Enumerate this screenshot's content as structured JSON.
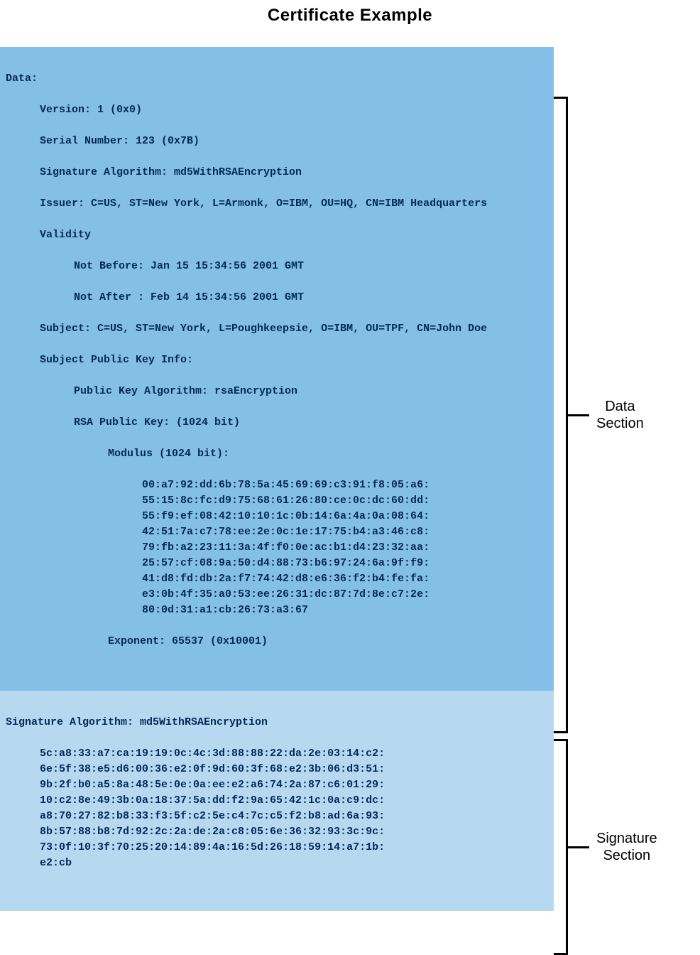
{
  "title": "Certificate Example",
  "labels": {
    "data_section": "Data\nSection",
    "signature_section": "Signature\nSection"
  },
  "cert": {
    "data_header": "Data:",
    "version": "Version: 1 (0x0)",
    "serial": "Serial Number: 123 (0x7B)",
    "sig_alg": "Signature Algorithm: md5WithRSAEncryption",
    "issuer": "Issuer: C=US, ST=New York, L=Armonk, O=IBM, OU=HQ, CN=IBM Headquarters",
    "validity": "Validity",
    "not_before": "Not Before: Jan 15 15:34:56 2001 GMT",
    "not_after": "Not After : Feb 14 15:34:56 2001 GMT",
    "subject": "Subject: C=US, ST=New York, L=Poughkeepsie, O=IBM, OU=TPF, CN=John Doe",
    "spki": "Subject Public Key Info:",
    "pk_alg": "Public Key Algorithm: rsaEncryption",
    "rsa_key": "RSA Public Key: (1024 bit)",
    "modulus": "Modulus (1024 bit):",
    "mod_lines": [
      "00:a7:92:dd:6b:78:5a:45:69:69:c3:91:f8:05:a6:",
      "55:15:8c:fc:d9:75:68:61:26:80:ce:0c:dc:60:dd:",
      "55:f9:ef:08:42:10:10:1c:0b:14:6a:4a:0a:08:64:",
      "42:51:7a:c7:78:ee:2e:0c:1e:17:75:b4:a3:46:c8:",
      "79:fb:a2:23:11:3a:4f:f0:0e:ac:b1:d4:23:32:aa:",
      "25:57:cf:08:9a:50:d4:88:73:b6:97:24:6a:9f:f9:",
      "41:d8:fd:db:2a:f7:74:42:d8:e6:36:f2:b4:fe:fa:",
      "e3:0b:4f:35:a0:53:ee:26:31:dc:87:7d:8e:c7:2e:",
      "80:0d:31:a1:cb:26:73:a3:67"
    ],
    "exponent": "Exponent: 65537 (0x10001)"
  },
  "sig": {
    "alg": "Signature Algorithm: md5WithRSAEncryption",
    "lines": [
      "5c:a8:33:a7:ca:19:19:0c:4c:3d:88:88:22:da:2e:03:14:c2:",
      "6e:5f:38:e5:d6:00:36:e2:0f:9d:60:3f:68:e2:3b:06:d3:51:",
      "9b:2f:b0:a5:8a:48:5e:0e:0a:ee:e2:a6:74:2a:87:c6:01:29:",
      "10:c2:8e:49:3b:0a:18:37:5a:dd:f2:9a:65:42:1c:0a:c9:dc:",
      "a8:70:27:82:b8:33:f3:5f:c2:5e:c4:7c:c5:f2:b8:ad:6a:93:",
      "8b:57:88:b8:7d:92:2c:2a:de:2a:c8:05:6e:36:32:93:3c:9c:",
      "73:0f:10:3f:70:25:20:14:89:4a:16:5d:26:18:59:14:a7:1b:",
      "e2:cb"
    ]
  }
}
